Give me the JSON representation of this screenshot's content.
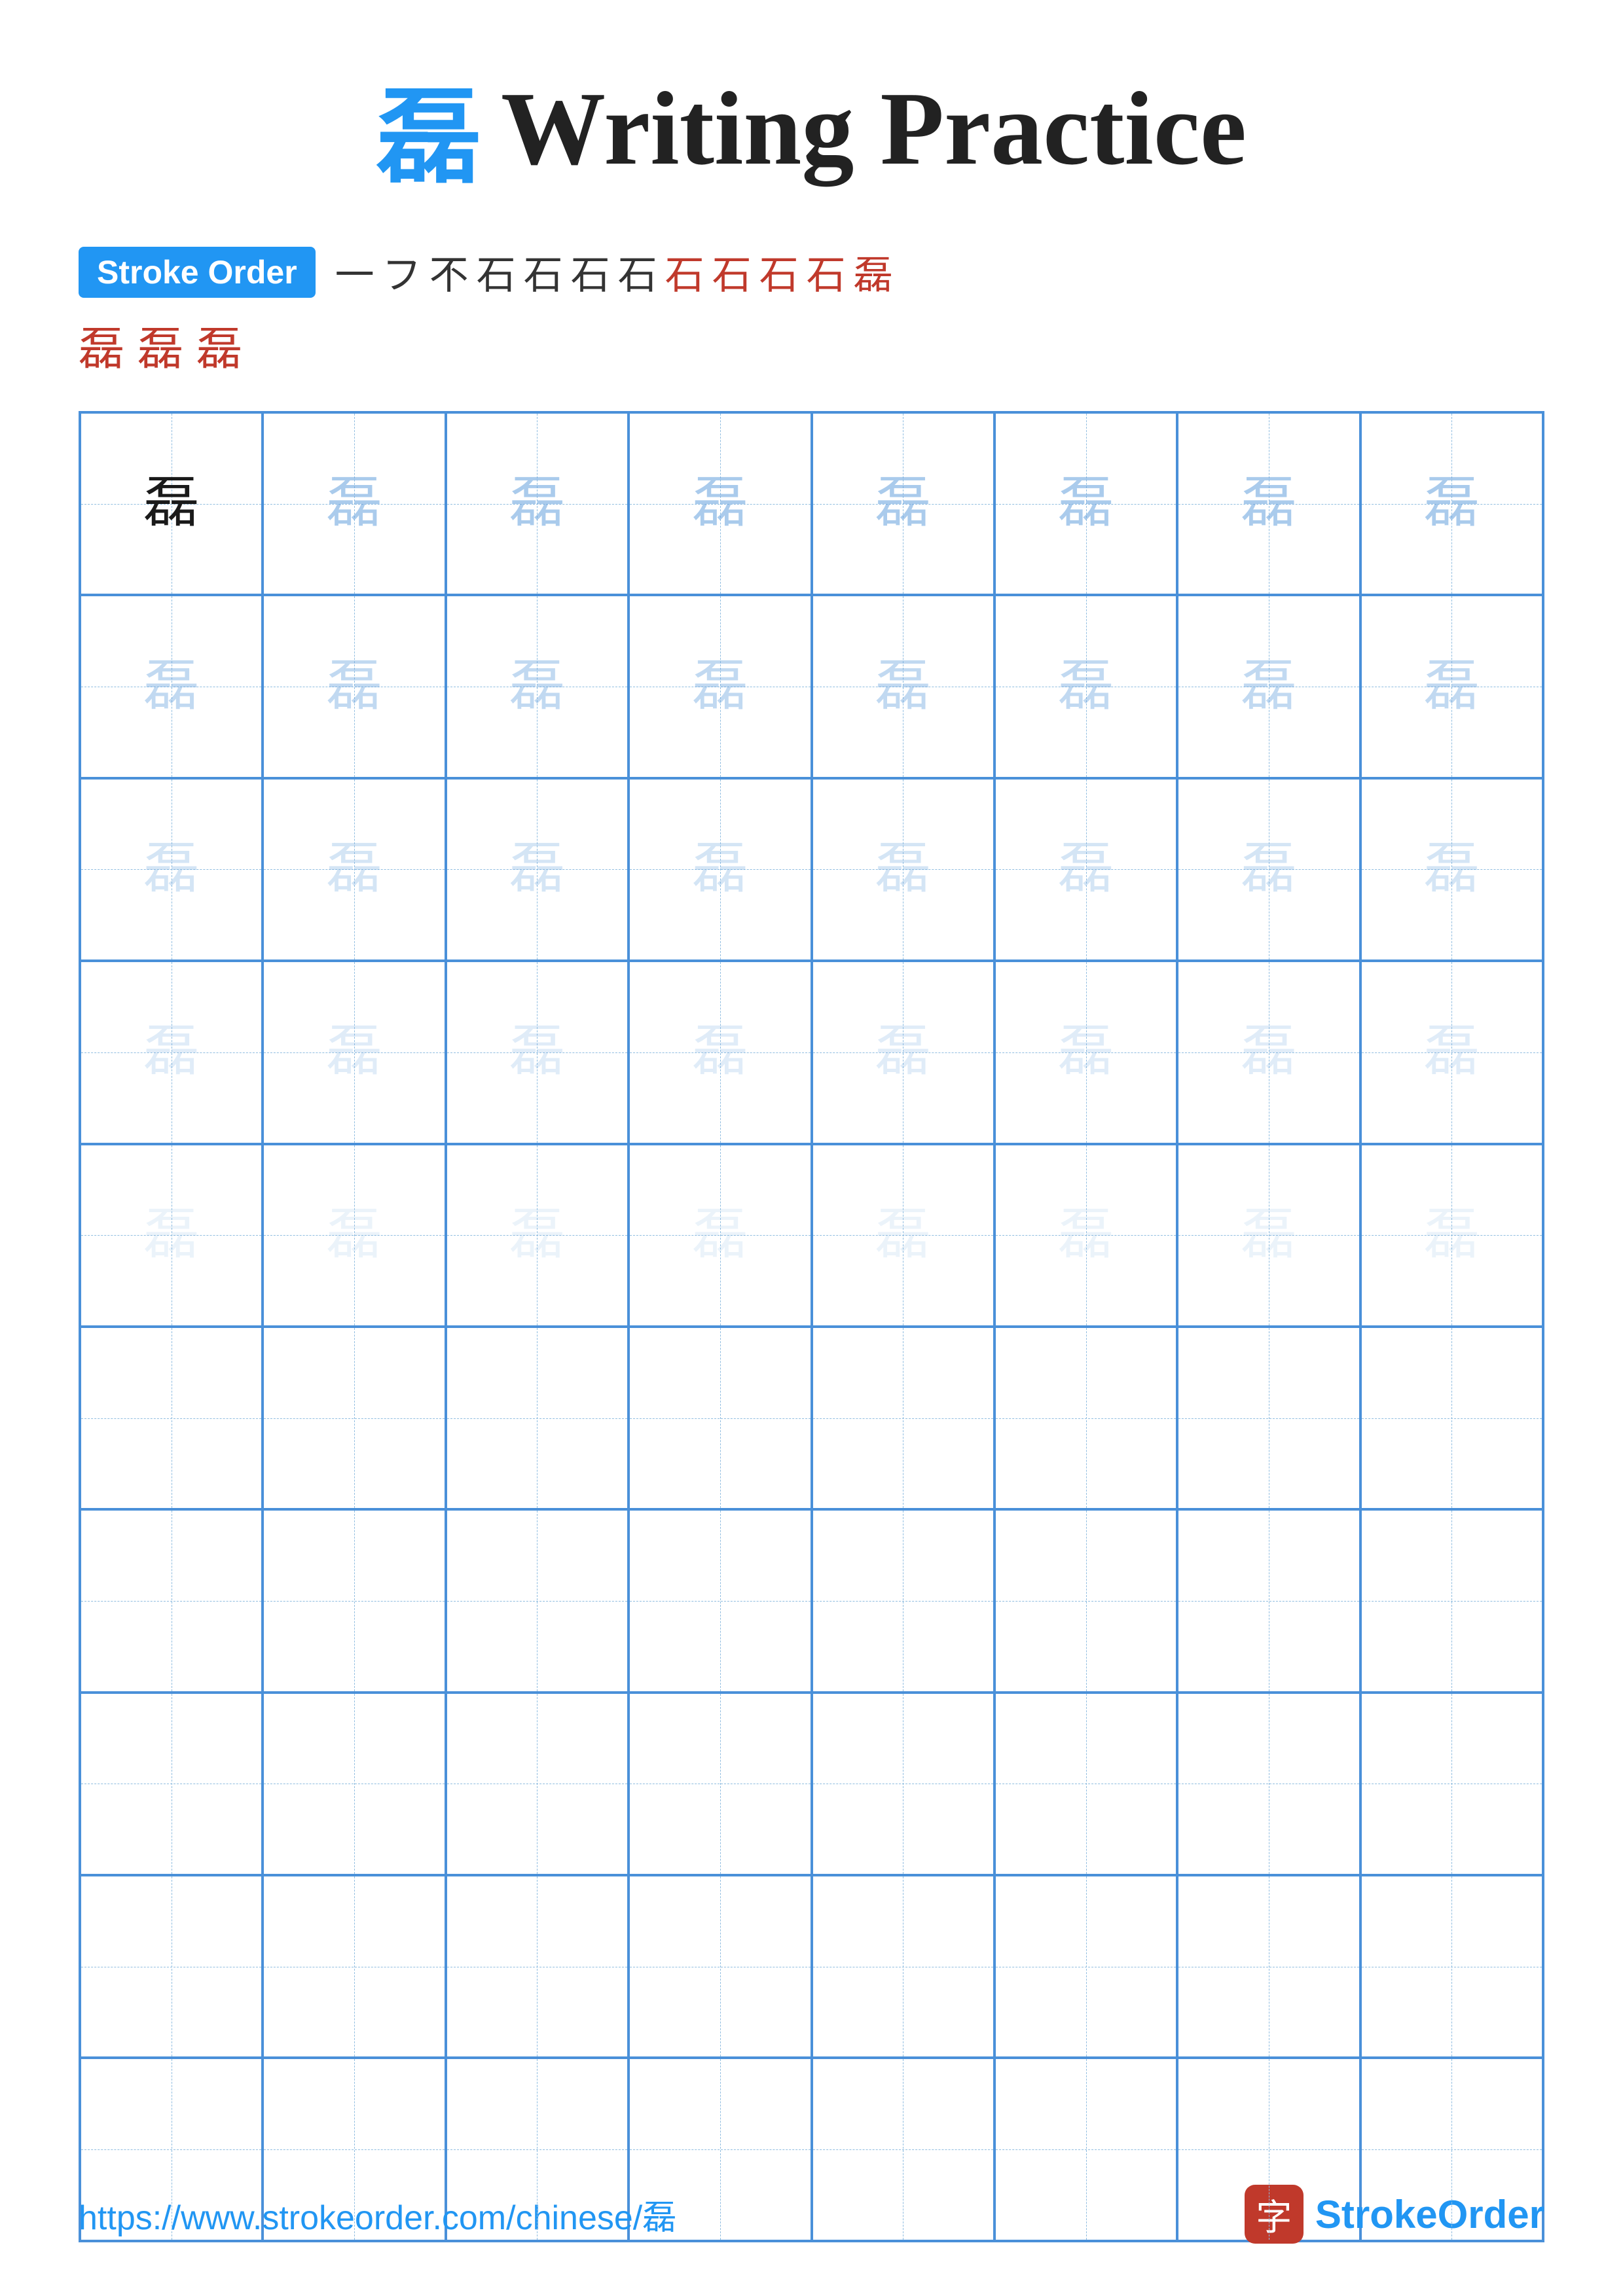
{
  "title": {
    "char": "磊",
    "text": "Writing Practice"
  },
  "stroke_order": {
    "badge_label": "Stroke Order",
    "strokes_row1": [
      "一",
      "フ",
      "不",
      "石",
      "石",
      "石",
      "石",
      "石",
      "石",
      "石",
      "石",
      "磊"
    ],
    "strokes_row2": [
      "磊",
      "磊",
      "磊"
    ]
  },
  "grid": {
    "char": "磊",
    "rows": 10,
    "cols": 8
  },
  "footer": {
    "url": "https://www.strokeorder.com/chinese/磊",
    "logo_char": "字",
    "logo_text_stroke": "Stroke",
    "logo_text_order": "Order"
  }
}
